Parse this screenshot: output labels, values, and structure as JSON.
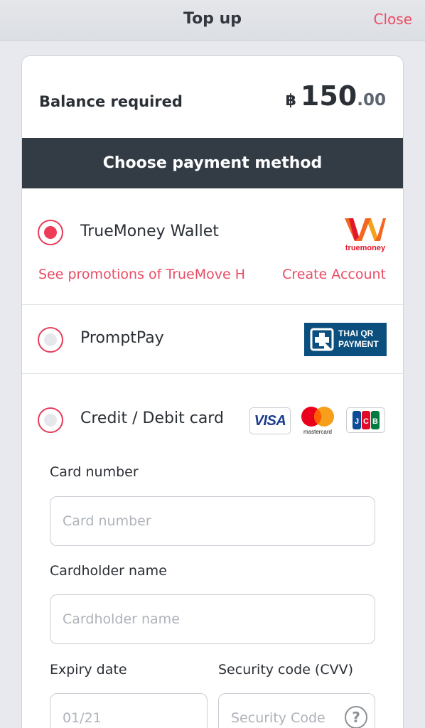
{
  "header": {
    "title": "Top up",
    "close_label": "Close"
  },
  "balance": {
    "label": "Balance required",
    "currency_symbol": "฿",
    "amount_integer": "150",
    "amount_decimal": ".00"
  },
  "payment": {
    "section_title": "Choose payment method",
    "options": [
      {
        "label": "TrueMoney Wallet",
        "selected": true,
        "logo": "truemoney-logo",
        "logo_text": "truemoney",
        "promo_link": "See promotions of TrueMove H",
        "create_account_link": "Create Account"
      },
      {
        "label": "PromptPay",
        "selected": false,
        "logo": "thai-qr-payment-logo",
        "logo_text_line1": "THAI QR",
        "logo_text_line2": "PAYMENT"
      },
      {
        "label": "Credit / Debit card",
        "selected": false,
        "card_logos": [
          {
            "name": "visa-logo",
            "text": "VISA"
          },
          {
            "name": "mastercard-logo",
            "text": "mastercard"
          },
          {
            "name": "jcb-logo",
            "text": "JCB"
          }
        ]
      }
    ]
  },
  "card_form": {
    "card_number": {
      "label": "Card number",
      "placeholder": "Card number"
    },
    "cardholder_name": {
      "label": "Cardholder name",
      "placeholder": "Cardholder name"
    },
    "expiry_date": {
      "label": "Expiry date",
      "placeholder": "01/21"
    },
    "security_code": {
      "label": "Security code (CVV)",
      "placeholder": "Security Code",
      "help_icon": "question-icon",
      "help_symbol": "?"
    }
  },
  "colors": {
    "accent": "#EE3B5A",
    "section_header_bg": "#333C45",
    "qr_logo_bg": "#0B4F7E",
    "visa_blue": "#1A3C8C"
  }
}
